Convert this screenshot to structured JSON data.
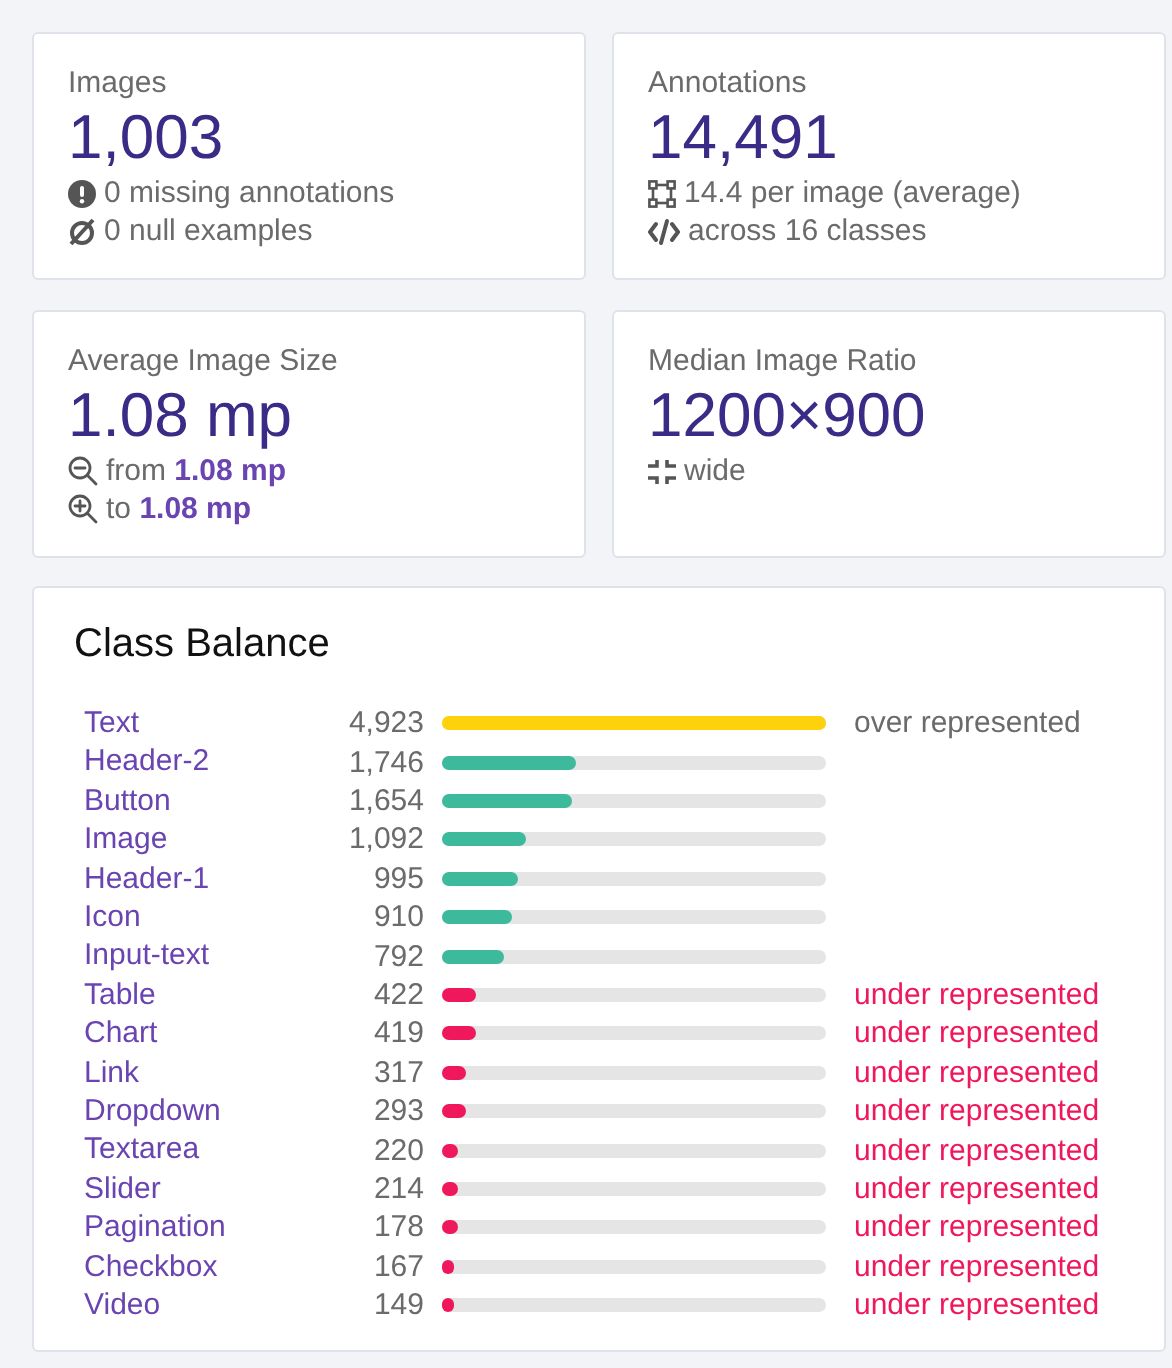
{
  "cards": [
    {
      "title": "Images",
      "value": "1,003",
      "lines": [
        {
          "kind": "alert",
          "text": "0 missing annotations"
        },
        {
          "kind": "null",
          "text": "0 null examples"
        }
      ]
    },
    {
      "title": "Annotations",
      "value": "14,491",
      "lines": [
        {
          "kind": "bbox",
          "text": "14.4 per image (average)"
        },
        {
          "kind": "code",
          "text": "across 16 classes"
        }
      ]
    },
    {
      "title": "Average Image Size",
      "value": "1.08 mp",
      "lines": [
        {
          "kind": "zoom-out",
          "text": "from **1.08 mp**"
        },
        {
          "kind": "zoom-in",
          "text": "to **1.08 mp**"
        }
      ]
    },
    {
      "title": "Median Image Ratio",
      "value": "1200×900",
      "lines": [
        {
          "kind": "compress",
          "text": "wide"
        }
      ]
    }
  ],
  "class_balance": {
    "title": "Class Balance",
    "rows": [
      {
        "name": "Text",
        "count": "4,923",
        "level": 1.0,
        "kind": "over",
        "note": "over represented"
      },
      {
        "name": "Header-2",
        "count": "1,746",
        "level": 0.35,
        "kind": "normal"
      },
      {
        "name": "Button",
        "count": "1,654",
        "level": 0.34,
        "kind": "normal"
      },
      {
        "name": "Image",
        "count": "1,092",
        "level": 0.22,
        "kind": "normal"
      },
      {
        "name": "Header-1",
        "count": "995",
        "level": 0.2,
        "kind": "normal"
      },
      {
        "name": "Icon",
        "count": "910",
        "level": 0.18,
        "kind": "normal"
      },
      {
        "name": "Input-text",
        "count": "792",
        "level": 0.16,
        "kind": "normal"
      },
      {
        "name": "Table",
        "count": "422",
        "level": 0.09,
        "kind": "under",
        "note": "under represented"
      },
      {
        "name": "Chart",
        "count": "419",
        "level": 0.09,
        "kind": "under",
        "note": "under represented"
      },
      {
        "name": "Link",
        "count": "317",
        "level": 0.06,
        "kind": "under",
        "note": "under represented"
      },
      {
        "name": "Dropdown",
        "count": "293",
        "level": 0.06,
        "kind": "under",
        "note": "under represented"
      },
      {
        "name": "Textarea",
        "count": "220",
        "level": 0.04,
        "kind": "under",
        "note": "under represented"
      },
      {
        "name": "Slider",
        "count": "214",
        "level": 0.04,
        "kind": "under",
        "note": "under represented"
      },
      {
        "name": "Pagination",
        "count": "178",
        "level": 0.04,
        "kind": "under",
        "note": "under represented"
      },
      {
        "name": "Checkbox",
        "count": "167",
        "level": 0.03,
        "kind": "under",
        "note": "under represented"
      },
      {
        "name": "Video",
        "count": "149",
        "level": 0.03,
        "kind": "under",
        "note": "under represented"
      }
    ]
  }
}
